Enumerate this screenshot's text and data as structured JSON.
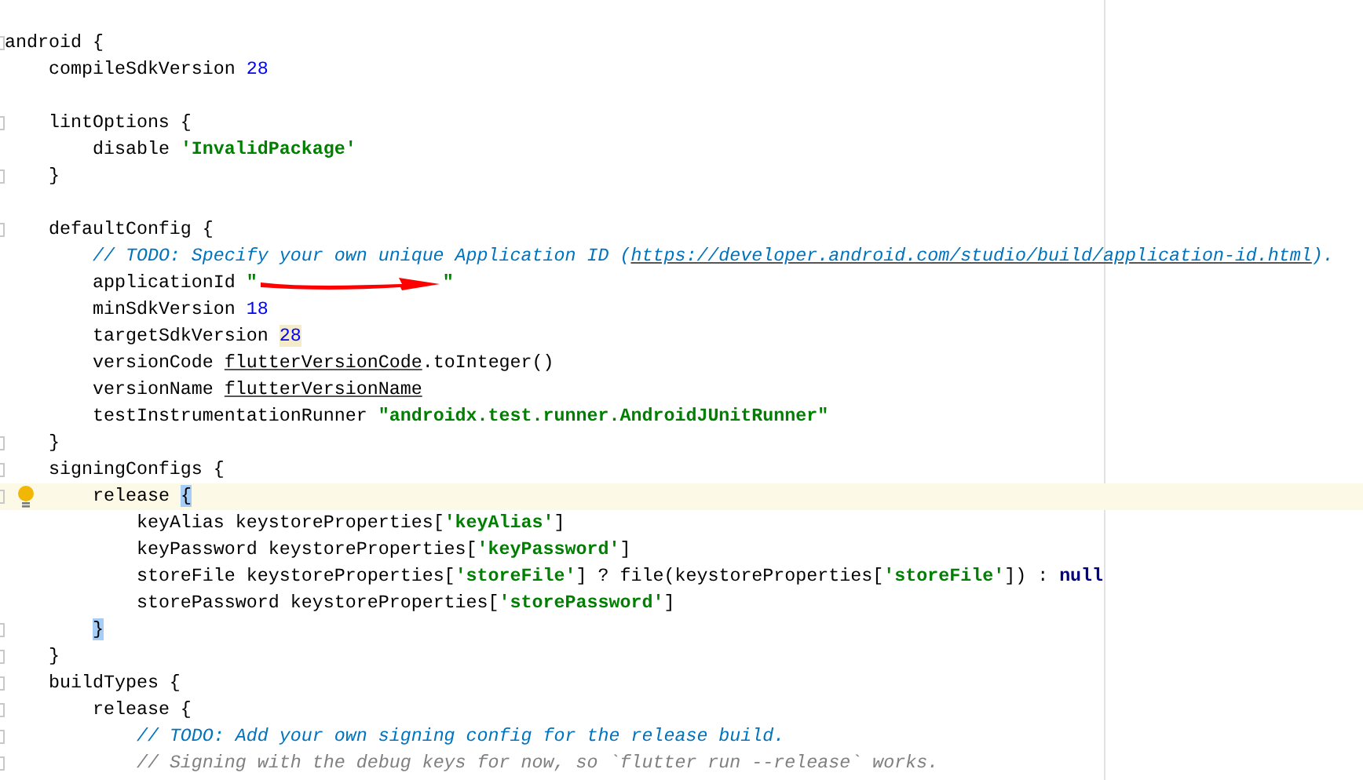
{
  "editor": {
    "lines": [
      {
        "fold": true,
        "tokens": [
          {
            "kind": "plain",
            "text": "android {"
          }
        ]
      },
      {
        "gap_after": true,
        "tokens": [
          {
            "kind": "plain",
            "text": "    compileSdkVersion "
          },
          {
            "kind": "number",
            "text": "28"
          }
        ]
      },
      {
        "fold": true,
        "tokens": [
          {
            "kind": "plain",
            "text": "    lintOptions {"
          }
        ]
      },
      {
        "tokens": [
          {
            "kind": "plain",
            "text": "        disable "
          },
          {
            "kind": "string",
            "text": "'InvalidPackage'"
          }
        ]
      },
      {
        "fold": true,
        "gap_after": true,
        "tokens": [
          {
            "kind": "plain",
            "text": "    }"
          }
        ]
      },
      {
        "fold": true,
        "tokens": [
          {
            "kind": "plain",
            "text": "    defaultConfig {"
          }
        ]
      },
      {
        "tokens": [
          {
            "kind": "todo",
            "text": "        // TODO: Specify your own unique Application ID ("
          },
          {
            "kind": "link",
            "text": "https://developer.android.com/studio/build/application-id.html"
          },
          {
            "kind": "todo",
            "text": ")."
          }
        ]
      },
      {
        "tokens": [
          {
            "kind": "plain",
            "text": "        applicationId "
          },
          {
            "kind": "string",
            "text": "\""
          },
          {
            "kind": "redacted"
          },
          {
            "kind": "string",
            "text": "\""
          }
        ]
      },
      {
        "tokens": [
          {
            "kind": "plain",
            "text": "        minSdkVersion "
          },
          {
            "kind": "number",
            "text": "18"
          }
        ]
      },
      {
        "tokens": [
          {
            "kind": "plain",
            "text": "        targetSdkVersion "
          },
          {
            "kind": "number",
            "text": "28",
            "highlighted": true
          }
        ]
      },
      {
        "tokens": [
          {
            "kind": "plain",
            "text": "        versionCode "
          },
          {
            "kind": "field",
            "text": "flutterVersionCode"
          },
          {
            "kind": "plain",
            "text": ".toInteger()"
          }
        ]
      },
      {
        "tokens": [
          {
            "kind": "plain",
            "text": "        versionName "
          },
          {
            "kind": "field",
            "text": "flutterVersionName"
          }
        ]
      },
      {
        "tokens": [
          {
            "kind": "plain",
            "text": "        testInstrumentationRunner "
          },
          {
            "kind": "string",
            "text": "\"androidx.test.runner.AndroidJUnitRunner\""
          }
        ]
      },
      {
        "fold": true,
        "tokens": [
          {
            "kind": "plain",
            "text": "    }"
          }
        ]
      },
      {
        "fold": true,
        "tokens": [
          {
            "kind": "plain",
            "text": "    signingConfigs {"
          }
        ]
      },
      {
        "fold": true,
        "current": true,
        "bulb": true,
        "tokens": [
          {
            "kind": "plain",
            "text": "        release "
          },
          {
            "kind": "plain",
            "text": "{",
            "highlighted": true
          }
        ]
      },
      {
        "tokens": [
          {
            "kind": "plain",
            "text": "            keyAlias keystoreProperties["
          },
          {
            "kind": "string",
            "text": "'keyAlias'"
          },
          {
            "kind": "plain",
            "text": "]"
          }
        ]
      },
      {
        "tokens": [
          {
            "kind": "plain",
            "text": "            keyPassword keystoreProperties["
          },
          {
            "kind": "string",
            "text": "'keyPassword'"
          },
          {
            "kind": "plain",
            "text": "]"
          }
        ]
      },
      {
        "tokens": [
          {
            "kind": "plain",
            "text": "            storeFile keystoreProperties["
          },
          {
            "kind": "string",
            "text": "'storeFile'"
          },
          {
            "kind": "plain",
            "text": "] ? file(keystoreProperties["
          },
          {
            "kind": "string",
            "text": "'storeFile'"
          },
          {
            "kind": "plain",
            "text": "]) : "
          },
          {
            "kind": "null",
            "text": "null"
          }
        ]
      },
      {
        "tokens": [
          {
            "kind": "plain",
            "text": "            storePassword keystoreProperties["
          },
          {
            "kind": "string",
            "text": "'storePassword'"
          },
          {
            "kind": "plain",
            "text": "]"
          }
        ]
      },
      {
        "fold": true,
        "tokens": [
          {
            "kind": "plain",
            "text": "        }",
            "highlighted": true
          }
        ]
      },
      {
        "fold": true,
        "tokens": [
          {
            "kind": "plain",
            "text": "    }"
          }
        ]
      },
      {
        "fold": true,
        "tokens": [
          {
            "kind": "plain",
            "text": "    buildTypes {"
          }
        ]
      },
      {
        "fold": true,
        "tokens": [
          {
            "kind": "plain",
            "text": "        release {"
          }
        ]
      },
      {
        "fold": true,
        "tokens": [
          {
            "kind": "todo",
            "text": "            // TODO: Add your own signing config for the release build."
          }
        ]
      },
      {
        "fold": true,
        "tokens": [
          {
            "kind": "comment",
            "text": "            // Signing with the debug keys for now, so `flutter run --release` works."
          }
        ]
      }
    ]
  }
}
